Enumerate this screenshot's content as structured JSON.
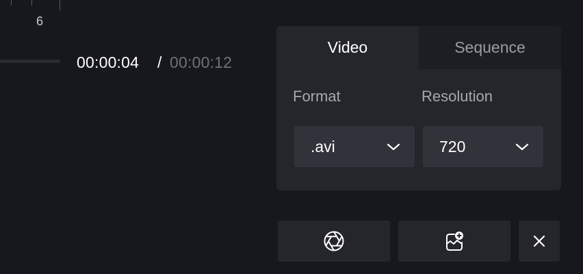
{
  "timeline": {
    "ruler_label": "6"
  },
  "playback": {
    "current_time": "00:00:04",
    "separator": "/",
    "total_time": "00:00:12"
  },
  "export_panel": {
    "tabs": [
      {
        "label": "Video",
        "active": true
      },
      {
        "label": "Sequence",
        "active": false
      }
    ],
    "format": {
      "label": "Format",
      "value": ".avi",
      "icon": "chevron-down-icon"
    },
    "resolution": {
      "label": "Resolution",
      "value": "720",
      "icon": "chevron-down-icon"
    }
  },
  "actions": [
    {
      "name": "aperture-capture-button",
      "icon": "aperture-icon"
    },
    {
      "name": "add-to-media-button",
      "icon": "image-add-icon"
    },
    {
      "name": "close-button",
      "icon": "close-icon"
    }
  ],
  "colors": {
    "background": "#17181d",
    "panel": "#25262c",
    "inactive_tab": "#1d1e23",
    "select": "#31323a",
    "muted_text": "#6f7178"
  }
}
